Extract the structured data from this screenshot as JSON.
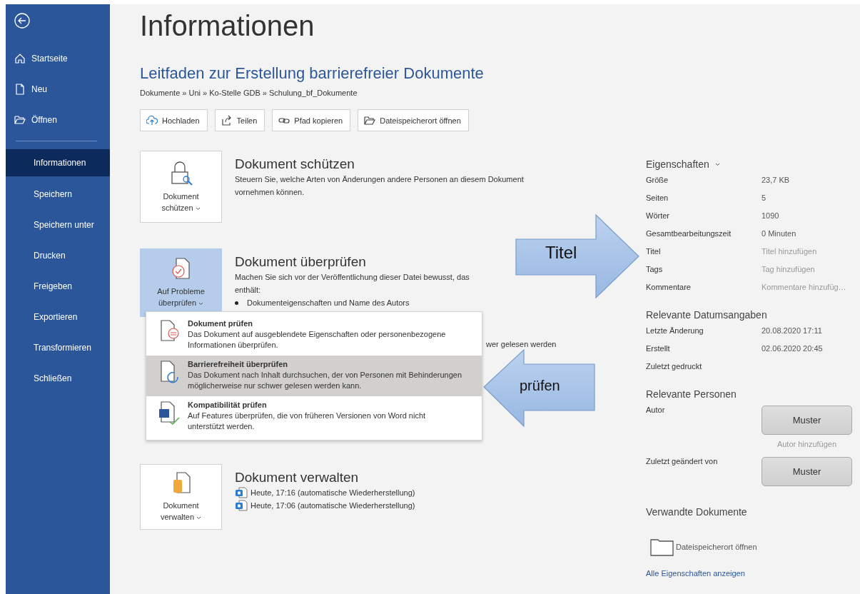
{
  "sidebar": {
    "items": [
      {
        "label": "Startseite",
        "kind": "home",
        "selected": false
      },
      {
        "label": "Neu",
        "kind": "new",
        "selected": false
      },
      {
        "label": "Öffnen",
        "kind": "open",
        "selected": false
      },
      {
        "label": "Informationen",
        "kind": "plain",
        "selected": true
      },
      {
        "label": "Speichern",
        "kind": "plain",
        "selected": false
      },
      {
        "label": "Speichern unter",
        "kind": "plain",
        "selected": false
      },
      {
        "label": "Drucken",
        "kind": "plain",
        "selected": false
      },
      {
        "label": "Freigeben",
        "kind": "plain",
        "selected": false
      },
      {
        "label": "Exportieren",
        "kind": "plain",
        "selected": false
      },
      {
        "label": "Transformieren",
        "kind": "plain",
        "selected": false
      },
      {
        "label": "Schließen",
        "kind": "plain",
        "selected": false
      }
    ]
  },
  "page_title": "Informationen",
  "document": {
    "title": "Leitfaden zur Erstellung barrierefreier Dokumente",
    "path": "Dokumente » Uni » Ko-Stelle GDB » Schulung_bf_Dokumente"
  },
  "toolbar": [
    {
      "label": "Hochladen",
      "kind": "upload"
    },
    {
      "label": "Teilen",
      "kind": "share"
    },
    {
      "label": "Pfad kopieren",
      "kind": "link"
    },
    {
      "label": "Dateispeicherort öffnen",
      "kind": "folder"
    }
  ],
  "sections": [
    {
      "kind": "protect",
      "button": "Dokument schützen",
      "title": "Dokument schützen",
      "lines": [
        "Steuern Sie, welche Arten von Änderungen andere Personen an diesem Dokument",
        "vornehmen können."
      ],
      "active": false
    },
    {
      "kind": "inspect",
      "button": "Auf Probleme überprüfen",
      "title": "Dokument überprüfen",
      "lines": [
        "Machen Sie sich vor der Veröffentlichung dieser Datei bewusst, das",
        "enthält:"
      ],
      "bullets": [
        "Dokumenteigenschaften und Name des Autors"
      ],
      "hidden_tail": "wer gelesen werden",
      "active": true
    },
    {
      "kind": "manage",
      "button": "Dokument verwalten",
      "title": "Dokument verwalten",
      "versions": [
        "Heute, 17:16 (automatische Wiederherstellung)",
        "Heute, 17:06 (automatische Wiederherstellung)"
      ],
      "active": false
    }
  ],
  "menu": [
    {
      "kind": "inspect",
      "title": "Dokument prüfen",
      "description": "Das Dokument auf ausgeblendete Eigenschaften oder personenbezogene Informationen überprüfen.",
      "selected": false
    },
    {
      "kind": "access",
      "title": "Barrierefreiheit überprüfen",
      "description": "Das Dokument nach Inhalt durchsuchen, der von Personen mit Behinderungen möglicherweise nur schwer gelesen werden kann.",
      "selected": true
    },
    {
      "kind": "compat",
      "title": "Kompatibilität prüfen",
      "description": "Auf Features überprüfen, die von früheren Versionen von Word nicht unterstützt werden.",
      "selected": false
    }
  ],
  "callouts": [
    {
      "kind": "right",
      "text": "Titel"
    },
    {
      "kind": "left",
      "text": "prüfen"
    }
  ],
  "properties": {
    "title": "Eigenschaften",
    "rows": [
      {
        "label": "Größe",
        "value": "23,7 KB",
        "prompt": false
      },
      {
        "label": "Seiten",
        "value": "5",
        "prompt": false
      },
      {
        "label": "Wörter",
        "value": "1090",
        "prompt": false
      },
      {
        "label": "Gesamtbearbeitungszeit",
        "value": "0 Minuten",
        "prompt": false
      },
      {
        "label": "Titel",
        "value": "Titel hinzufügen",
        "prompt": true
      },
      {
        "label": "Tags",
        "value": "Tag hinzufügen",
        "prompt": true
      },
      {
        "label": "Kommentare",
        "value": "Kommentare hinzufüg…",
        "prompt": true
      }
    ]
  },
  "dates": {
    "title": "Relevante Datumsangaben",
    "rows": [
      {
        "label": "Letzte Änderung",
        "value": "20.08.2020 17:11"
      },
      {
        "label": "Erstellt",
        "value": "02.06.2020 20:45"
      },
      {
        "label": "Zuletzt gedruckt"
      }
    ]
  },
  "people": {
    "title": "Relevante Personen",
    "rows": [
      {
        "label": "Autor",
        "name": "Muster",
        "hint": "Autor hinzufügen"
      },
      {
        "label": "Zuletzt geändert von",
        "name": "Muster"
      }
    ]
  },
  "related": {
    "title": "Verwandte Dokumente",
    "folder": "Dateispeicherort öffnen",
    "link": "Alle Eigenschaften anzeigen"
  }
}
